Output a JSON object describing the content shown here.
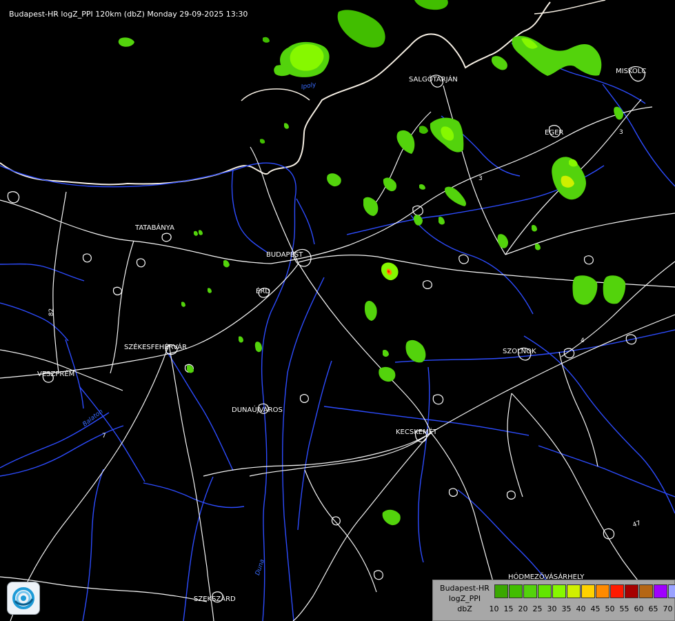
{
  "radar": {
    "title": "Budapest-HR logZ_PPI 120km (dbZ) Monday 29-09-2025 13:30"
  },
  "cities": [
    "SALGÓTARJÁN",
    "MISKOLC",
    "EGER",
    "TATABÁNYA",
    "BUDAPEST",
    "ÉRD",
    "SZÉKESFEHÉRVÁR",
    "VESZPRÉM",
    "SZOLNOK",
    "DUNAÚJVÁROS",
    "KECSKEMÉT",
    "HÓDMEZŐVÁSÁRHELY",
    "SZEKSZÁRD"
  ],
  "roads": [
    "3",
    "3",
    "82",
    "4",
    "7",
    "47"
  ],
  "rivers": [
    "Ipoly",
    "Balaton",
    "Duna"
  ],
  "legend": {
    "line1": "Budapest-HR",
    "line2": "logZ_PPI",
    "line3": "dbZ",
    "ticks": [
      "10",
      "15",
      "20",
      "25",
      "30",
      "35",
      "40",
      "45",
      "50",
      "55",
      "60",
      "65",
      "70"
    ],
    "colors": [
      "#3aa800",
      "#41be00",
      "#53d30c",
      "#62e500",
      "#86f800",
      "#cff000",
      "#ffd200",
      "#ff8a00",
      "#ff1a00",
      "#a60000",
      "#b56614",
      "#a000ff",
      "#9aa2ff"
    ]
  }
}
